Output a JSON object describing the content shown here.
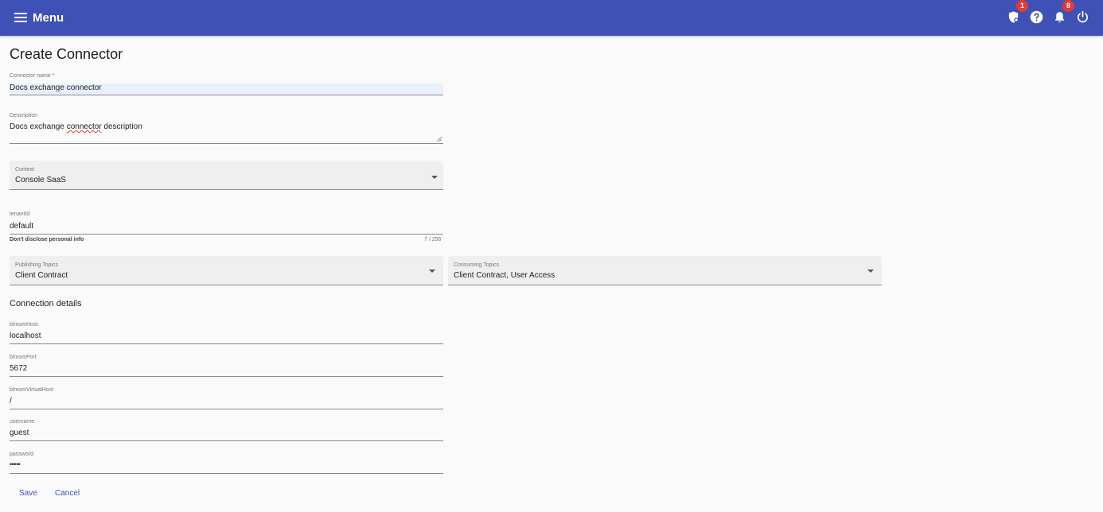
{
  "header": {
    "menu_label": "Menu",
    "icons": [
      "policy-icon",
      "help-icon",
      "notifications-icon",
      "power-icon"
    ],
    "badge_policy": "1",
    "badge_notifications": "8",
    "bar_color": "#3f51b5"
  },
  "page": {
    "title": "Create Connector"
  },
  "form": {
    "connector_name": {
      "label": "Connector name *",
      "value": "Docs exchange connector"
    },
    "description": {
      "label": "Description",
      "value_prefix": "Docs exchange ",
      "value_misspelled": "connector",
      "value_suffix": " description"
    },
    "context": {
      "label": "Context",
      "value": "Console SaaS"
    },
    "tenant": {
      "label": "tenantId",
      "value": "default",
      "hint": "Don't disclose personal info",
      "counter": "7 / 256"
    },
    "publishing_topics": {
      "label": "Publishing Topics",
      "value": "Client Contract"
    },
    "consuming_topics": {
      "label": "Consuming Topics",
      "value": "Client Contract, User Access"
    }
  },
  "connection": {
    "title": "Connection details",
    "host": {
      "label": "blmomHost",
      "value": "localhost"
    },
    "port": {
      "label": "blmomPort",
      "value": "5672"
    },
    "vhost": {
      "label": "blmomVirtualHost",
      "value": "/"
    },
    "username": {
      "label": "username",
      "value": "guest"
    },
    "password": {
      "label": "password",
      "value": "•••••"
    }
  },
  "actions": {
    "save_label": "Save",
    "cancel_label": "Cancel"
  }
}
